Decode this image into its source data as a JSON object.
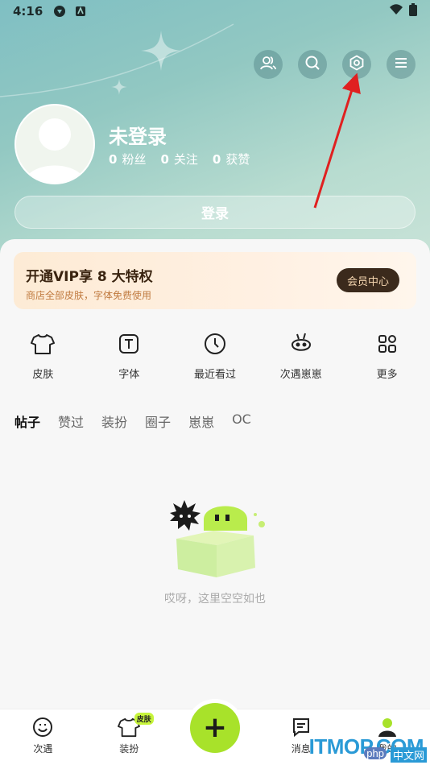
{
  "status_bar": {
    "time": "4:16"
  },
  "profile": {
    "name": "未登录",
    "stats": [
      {
        "value": "0",
        "label": "粉丝"
      },
      {
        "value": "0",
        "label": "关注"
      },
      {
        "value": "0",
        "label": "获赞"
      }
    ],
    "login_label": "登录"
  },
  "top_actions": [
    {
      "icon": "friends-icon"
    },
    {
      "icon": "search-icon"
    },
    {
      "icon": "settings-icon"
    },
    {
      "icon": "menu-icon"
    }
  ],
  "vip": {
    "title": "开通VIP享 8 大特权",
    "subtitle": "商店全部皮肤，字体免费使用",
    "button": "会员中心"
  },
  "features": [
    {
      "label": "皮肤",
      "icon": "shirt-icon"
    },
    {
      "label": "字体",
      "icon": "font-icon"
    },
    {
      "label": "最近看过",
      "icon": "clock-icon"
    },
    {
      "label": "次遇崽崽",
      "icon": "pet-icon"
    },
    {
      "label": "更多",
      "icon": "grid-icon"
    }
  ],
  "tabs": [
    "帖子",
    "赞过",
    "装扮",
    "圈子",
    "崽崽",
    "OC"
  ],
  "active_tab": "帖子",
  "empty_text": "哎呀，这里空空如也",
  "bottom_nav": [
    {
      "label": "次遇",
      "icon": "smile-icon"
    },
    {
      "label": "装扮",
      "icon": "shirt-icon",
      "badge": "皮肤"
    },
    {
      "label": "",
      "icon": "plus-icon"
    },
    {
      "label": "消息",
      "icon": "message-icon"
    },
    {
      "label": "我的",
      "icon": "profile-icon"
    }
  ],
  "fab_label": "+",
  "watermark": {
    "main": "ITMOP.COM",
    "php": "php",
    "sub": "中文网"
  },
  "colors": {
    "accent_green": "#a8e22a",
    "vip_dark": "#3b2a1c",
    "arrow_red": "#e02020"
  }
}
